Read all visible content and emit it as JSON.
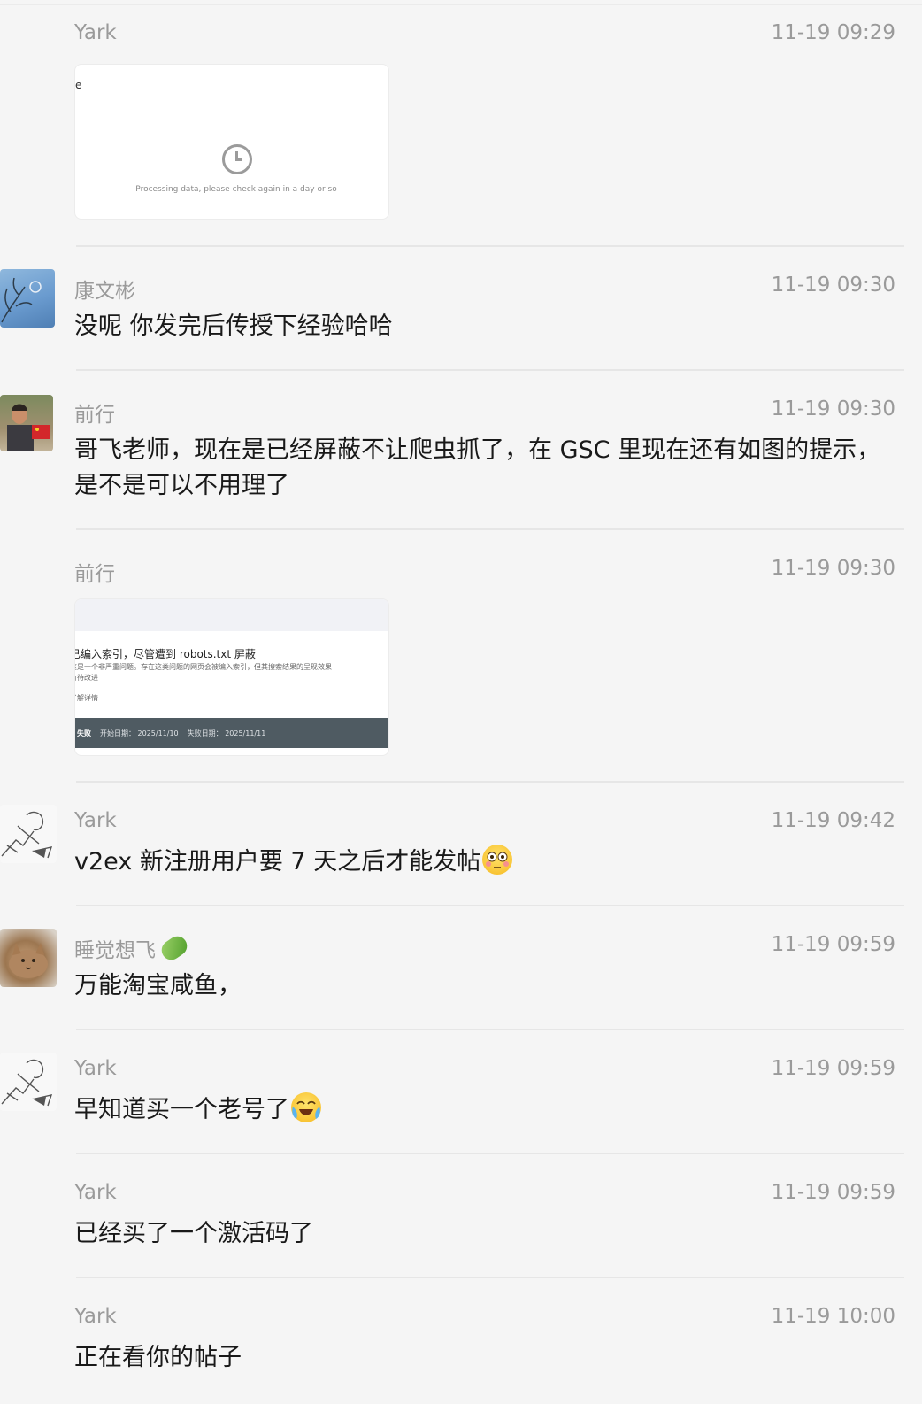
{
  "messages": [
    {
      "sender": "Yark",
      "time": "11-19 09:29",
      "image": {
        "letter": "e",
        "caption": "Processing data, please check again in a day or so"
      }
    },
    {
      "sender": "康文彬",
      "time": "11-19 09:30",
      "text": "没呢 你发完后传授下经验哈哈"
    },
    {
      "sender": "前行",
      "time": "11-19 09:30",
      "text": "哥飞老师，现在是已经屏蔽不让爬虫抓了，在 GSC 里现在还有如图的提示，是不是可以不用理了"
    },
    {
      "sender": "前行",
      "time": "11-19 09:30",
      "image": {
        "title": "已编入索引，尽管遭到 robots.txt 屏蔽",
        "line1": "这是一个非严重问题。存在这类问题的网页会被编入索引，但其搜索结果的呈现效果",
        "line2": "有待改进",
        "link": "了解详情",
        "status": "失败",
        "start": "开始日期： 2025/11/10",
        "fail": "失败日期： 2025/11/11"
      }
    },
    {
      "sender": "Yark",
      "time": "11-19 09:42",
      "text": "v2ex 新注册用户要 7 天之后才能发帖",
      "emoji": "flushed-face"
    },
    {
      "sender": "睡觉想飞",
      "time": "11-19 09:59",
      "text": "万能淘宝咸鱼，",
      "sender_icon": "bean-sprout-icon"
    },
    {
      "sender": "Yark",
      "time": "11-19 09:59",
      "text": "早知道买一个老号了",
      "emoji": "crying-laughing-face"
    },
    {
      "sender": "Yark",
      "time": "11-19 09:59",
      "text": "已经买了一个激活码了"
    },
    {
      "sender": "Yark",
      "time": "11-19 10:00",
      "text": "正在看你的帖子"
    }
  ]
}
